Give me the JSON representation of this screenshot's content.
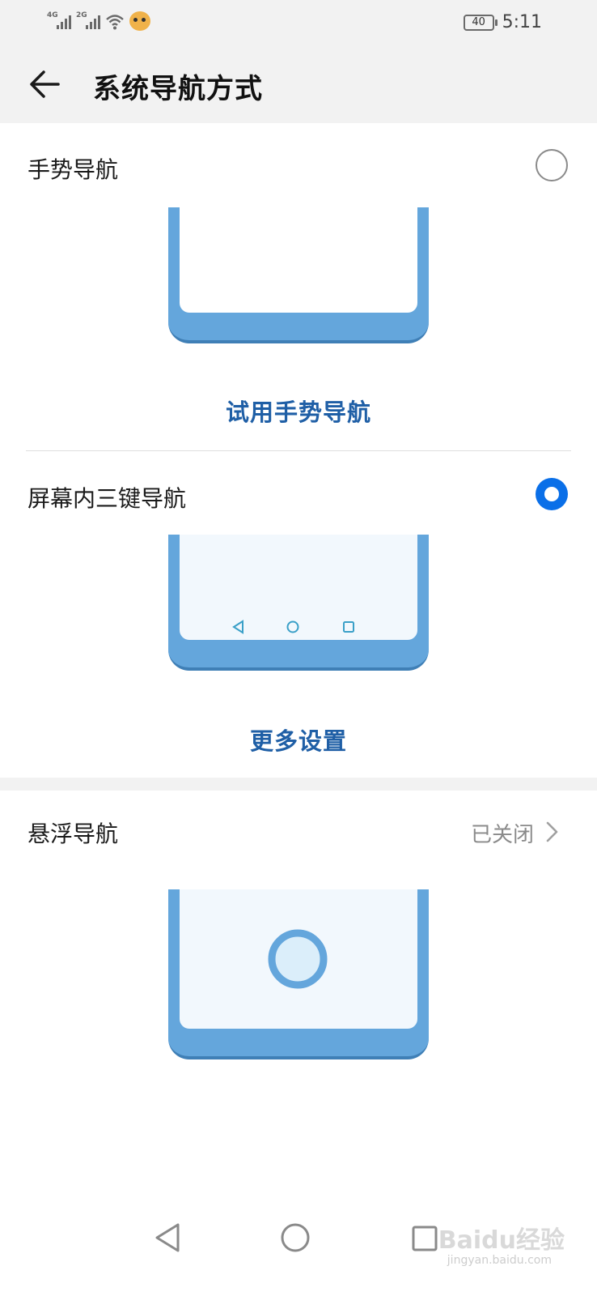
{
  "status_bar": {
    "network_1": "4G",
    "network_2": "2G",
    "battery": "40",
    "time": "5:11"
  },
  "header": {
    "title": "系统导航方式",
    "back_icon": "arrow-left-icon"
  },
  "options": {
    "gesture": {
      "label": "手势导航",
      "selected": false,
      "link": "试用手势导航"
    },
    "three_key": {
      "label": "屏幕内三键导航",
      "selected": true,
      "link": "更多设置"
    },
    "floating": {
      "label": "悬浮导航",
      "status": "已关闭"
    }
  },
  "colors": {
    "accent": "#0a6fe8",
    "link": "#1f5fa6",
    "illustration": "#64a6dc"
  },
  "system_nav": {
    "back": "triangle-back-icon",
    "home": "circle-home-icon",
    "recents": "square-recents-icon"
  },
  "watermark": {
    "brand": "Baidu经验",
    "url": "jingyan.baidu.com"
  }
}
